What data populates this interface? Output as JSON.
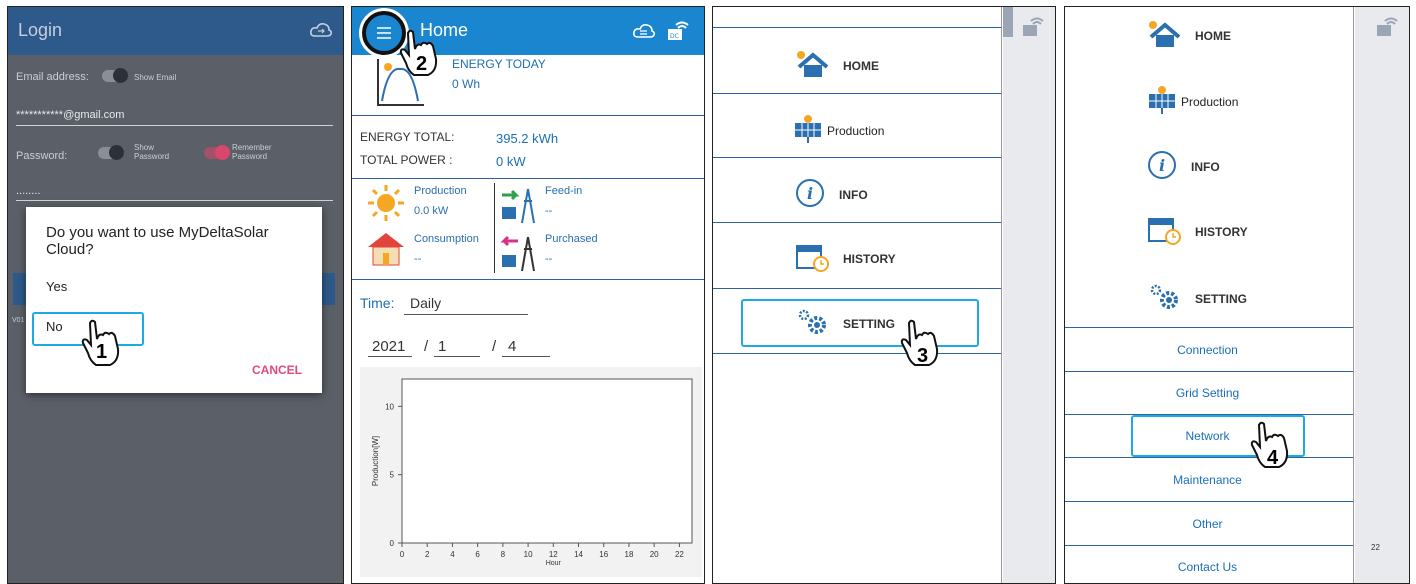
{
  "panel1": {
    "title": "Login",
    "email_label": "Email address:",
    "show_email": "Show Email",
    "email_value": "***********@gmail.com",
    "password_label": "Password:",
    "show_password": "Show\nPassword",
    "remember_password": "Remember\nPassword",
    "password_value": "........",
    "version_prefix": "V01",
    "dialog": {
      "question": "Do you want to use MyDeltaSolar Cloud?",
      "yes": "Yes",
      "no": "No",
      "cancel": "CANCEL"
    },
    "step": "1"
  },
  "panel2": {
    "title": "Home",
    "step": "2",
    "energy_today_label": "ENERGY TODAY",
    "energy_today_value": "0 Wh",
    "energy_total_label": "ENERGY TOTAL:",
    "energy_total_value": "395.2 kWh",
    "total_power_label": "TOTAL POWER :",
    "total_power_value": "0 kW",
    "production_label": "Production",
    "production_value": "0.0 kW",
    "feedin_label": "Feed-in",
    "feedin_value": "--",
    "consumption_label": "Consumption",
    "consumption_value": "--",
    "purchased_label": "Purchased",
    "purchased_value": "--",
    "time_label": "Time:",
    "time_value": "Daily",
    "date_year": "2021",
    "date_month": "1",
    "date_day": "4",
    "date_sep": "/",
    "chart": {
      "ylabel": "Production[W]",
      "xlabel": "Hour",
      "yticks": [
        "10",
        "5",
        "0"
      ],
      "xticks": [
        "0",
        "2",
        "4",
        "6",
        "8",
        "10",
        "12",
        "14",
        "16",
        "18",
        "20",
        "22"
      ]
    }
  },
  "panel3": {
    "items": [
      "HOME",
      "Production",
      "INFO",
      "HISTORY",
      "SETTING"
    ],
    "step": "3"
  },
  "panel4": {
    "items": [
      "HOME",
      "Production",
      "INFO",
      "HISTORY",
      "SETTING"
    ],
    "sub_items": [
      "Connection",
      "Grid Setting",
      "Network",
      "Maintenance",
      "Other",
      "Contact Us"
    ],
    "step": "4",
    "right_tick": "22"
  },
  "chart_data": {
    "type": "line",
    "title": "",
    "xlabel": "Hour",
    "ylabel": "Production[W]",
    "x": [
      0,
      2,
      4,
      6,
      8,
      10,
      12,
      14,
      16,
      18,
      20,
      22
    ],
    "series": [],
    "ylim": [
      0,
      12
    ],
    "grid": false
  },
  "colors": {
    "accent_blue": "#1a86d0",
    "highlight": "#1da9e3",
    "cancel_pink": "#e04a77",
    "toggle_on": "#d9476a"
  }
}
